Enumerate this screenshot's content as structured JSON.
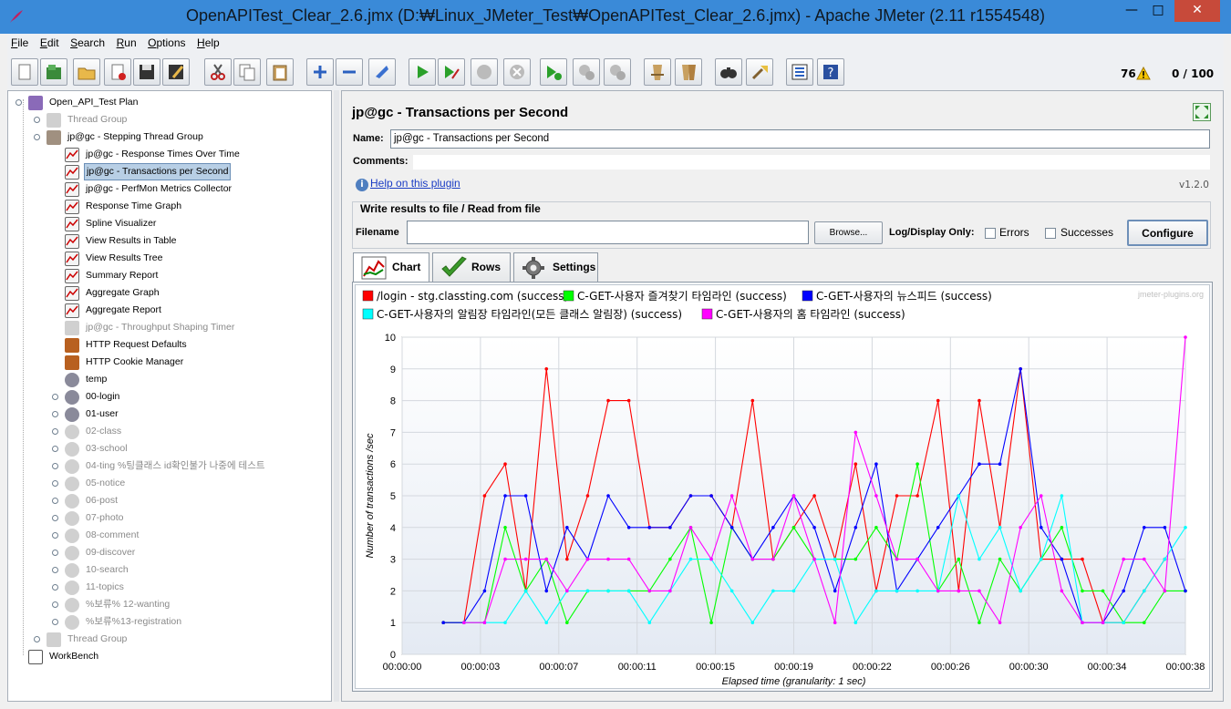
{
  "window": {
    "title": "OpenAPITest_Clear_2.6.jmx (D:₩Linux_JMeter_Test₩OpenAPITest_Clear_2.6.jmx) - Apache JMeter (2.11 r1554548)",
    "minimize": "—",
    "maximize": "□",
    "close": "✕"
  },
  "menu": [
    "File",
    "Edit",
    "Search",
    "Run",
    "Options",
    "Help"
  ],
  "toolbar": {
    "buttons": [
      "new-icon",
      "templates-icon",
      "open-icon",
      "close-file-icon",
      "save-icon",
      "save-as-icon",
      "cut-icon",
      "copy-icon",
      "paste-icon",
      "expand-icon",
      "collapse-icon",
      "toggle-icon",
      "start-icon",
      "start-no-pause-icon",
      "stop-icon",
      "shutdown-icon",
      "remote-start-icon",
      "remote-stop-icon",
      "remote-shutdown-icon",
      "clear-icon",
      "clear-all-icon",
      "search-icon",
      "reset-search-icon",
      "function-helper-icon",
      "help-icon"
    ],
    "error_count": "76",
    "threads": "0 / 100"
  },
  "tree": {
    "nodes": [
      {
        "label": "Open_API_Test Plan",
        "level": 0,
        "icon": "test-plan-icon",
        "disabled": false,
        "selected": false,
        "toggle": true
      },
      {
        "label": "Thread Group",
        "level": 1,
        "icon": "thread-group-icon",
        "disabled": true,
        "selected": false,
        "toggle": true
      },
      {
        "label": "jp@gc - Stepping Thread Group",
        "level": 1,
        "icon": "thread-group-icon",
        "disabled": false,
        "selected": false,
        "toggle": true
      },
      {
        "label": "jp@gc - Response Times Over Time",
        "level": 2,
        "icon": "listener-icon",
        "disabled": false,
        "selected": false
      },
      {
        "label": "jp@gc - Transactions per Second",
        "level": 2,
        "icon": "listener-icon",
        "disabled": false,
        "selected": true
      },
      {
        "label": "jp@gc - PerfMon Metrics Collector",
        "level": 2,
        "icon": "listener-icon",
        "disabled": false,
        "selected": false
      },
      {
        "label": "Response Time Graph",
        "level": 2,
        "icon": "listener-icon",
        "disabled": false,
        "selected": false
      },
      {
        "label": "Spline Visualizer",
        "level": 2,
        "icon": "listener-icon",
        "disabled": false,
        "selected": false
      },
      {
        "label": "View Results in Table",
        "level": 2,
        "icon": "listener-icon",
        "disabled": false,
        "selected": false
      },
      {
        "label": "View Results Tree",
        "level": 2,
        "icon": "listener-icon",
        "disabled": false,
        "selected": false
      },
      {
        "label": "Summary Report",
        "level": 2,
        "icon": "listener-icon",
        "disabled": false,
        "selected": false
      },
      {
        "label": "Aggregate Graph",
        "level": 2,
        "icon": "listener-icon",
        "disabled": false,
        "selected": false
      },
      {
        "label": "Aggregate Report",
        "level": 2,
        "icon": "listener-icon",
        "disabled": false,
        "selected": false
      },
      {
        "label": "jp@gc - Throughput Shaping Timer",
        "level": 2,
        "icon": "timer-icon",
        "disabled": true,
        "selected": false
      },
      {
        "label": "HTTP Request Defaults",
        "level": 2,
        "icon": "config-icon",
        "disabled": false,
        "selected": false
      },
      {
        "label": "HTTP Cookie Manager",
        "level": 2,
        "icon": "config-icon",
        "disabled": false,
        "selected": false
      },
      {
        "label": "temp",
        "level": 2,
        "icon": "controller-icon",
        "disabled": false,
        "selected": false
      },
      {
        "label": "00-login",
        "level": 2,
        "icon": "controller-icon",
        "disabled": false,
        "selected": false,
        "toggle": true
      },
      {
        "label": "01-user",
        "level": 2,
        "icon": "controller-icon",
        "disabled": false,
        "selected": false,
        "toggle": true
      },
      {
        "label": "02-class",
        "level": 2,
        "icon": "controller-icon",
        "disabled": true,
        "selected": false,
        "toggle": true
      },
      {
        "label": "03-school",
        "level": 2,
        "icon": "controller-icon",
        "disabled": true,
        "selected": false,
        "toggle": true
      },
      {
        "label": "04-ting %팅클래스 id확인불가 나중에 테스트",
        "level": 2,
        "icon": "controller-icon",
        "disabled": true,
        "selected": false,
        "toggle": true
      },
      {
        "label": "05-notice",
        "level": 2,
        "icon": "controller-icon",
        "disabled": true,
        "selected": false,
        "toggle": true
      },
      {
        "label": "06-post",
        "level": 2,
        "icon": "controller-icon",
        "disabled": true,
        "selected": false,
        "toggle": true
      },
      {
        "label": "07-photo",
        "level": 2,
        "icon": "controller-icon",
        "disabled": true,
        "selected": false,
        "toggle": true
      },
      {
        "label": "08-comment",
        "level": 2,
        "icon": "controller-icon",
        "disabled": true,
        "selected": false,
        "toggle": true
      },
      {
        "label": "09-discover",
        "level": 2,
        "icon": "controller-icon",
        "disabled": true,
        "selected": false,
        "toggle": true
      },
      {
        "label": "10-search",
        "level": 2,
        "icon": "controller-icon",
        "disabled": true,
        "selected": false,
        "toggle": true
      },
      {
        "label": "11-topics",
        "level": 2,
        "icon": "controller-icon",
        "disabled": true,
        "selected": false,
        "toggle": true
      },
      {
        "label": "%보류% 12-wanting",
        "level": 2,
        "icon": "controller-icon",
        "disabled": true,
        "selected": false,
        "toggle": true
      },
      {
        "label": "%보류%13-registration",
        "level": 2,
        "icon": "controller-icon",
        "disabled": true,
        "selected": false,
        "toggle": true
      },
      {
        "label": "Thread Group",
        "level": 1,
        "icon": "thread-group-icon",
        "disabled": true,
        "selected": false,
        "toggle": true
      },
      {
        "label": "WorkBench",
        "level": 0,
        "icon": "workbench-icon",
        "disabled": false,
        "selected": false
      }
    ]
  },
  "panel": {
    "title": "jp@gc - Transactions per Second",
    "name_label": "Name:",
    "name_value": "jp@gc - Transactions per Second",
    "comments_label": "Comments:",
    "help_link": "Help on this plugin",
    "version": "v1.2.0",
    "write_title": "Write results to file / Read from file",
    "filename_label": "Filename",
    "browse": "Browse...",
    "log_display_label": "Log/Display Only:",
    "errors_label": "Errors",
    "successes_label": "Successes",
    "configure": "Configure",
    "tabs": [
      "Chart",
      "Rows",
      "Settings"
    ],
    "watermark": "jmeter-plugins.org"
  },
  "chart_data": {
    "type": "line",
    "xlabel": "Elapsed time (granularity: 1 sec)",
    "ylabel": "Number of transactions /sec",
    "ylim": [
      0,
      10
    ],
    "xlim": [
      0,
      38
    ],
    "x_ticks": [
      "00:00:00",
      "00:00:03",
      "00:00:07",
      "00:00:11",
      "00:00:15",
      "00:00:19",
      "00:00:22",
      "00:00:26",
      "00:00:30",
      "00:00:34",
      "00:00:38"
    ],
    "y_ticks": [
      0,
      1,
      2,
      3,
      4,
      5,
      6,
      7,
      8,
      9,
      10
    ],
    "legend_position": "top",
    "grid": true,
    "series": [
      {
        "name": "/login - stg.classting.com (success)",
        "color": "#ff0000",
        "x": [
          2,
          3,
          4,
          5,
          6,
          7,
          8,
          9,
          10,
          11,
          12,
          13,
          14,
          15,
          16,
          17,
          18,
          19,
          20,
          21,
          22,
          23,
          24,
          25,
          26,
          27,
          28,
          29,
          30,
          31,
          32,
          33,
          34,
          35,
          36,
          37
        ],
        "y": [
          1,
          1,
          5,
          6,
          2,
          9,
          3,
          5,
          8,
          8,
          4,
          4,
          5,
          5,
          4,
          8,
          3,
          4,
          5,
          3,
          6,
          2,
          5,
          5,
          8,
          2,
          8,
          4,
          9,
          3,
          3,
          3,
          1,
          1,
          2,
          3
        ]
      },
      {
        "name": "C-GET-사용자 즐겨찾기 타임라인 (success)",
        "color": "#00ff00",
        "x": [
          2,
          3,
          4,
          5,
          6,
          7,
          8,
          9,
          10,
          11,
          12,
          13,
          14,
          15,
          16,
          17,
          18,
          19,
          20,
          21,
          22,
          23,
          24,
          25,
          26,
          27,
          28,
          29,
          30,
          31,
          32,
          33,
          34,
          35,
          36,
          37,
          38
        ],
        "y": [
          1,
          1,
          1,
          4,
          2,
          3,
          1,
          2,
          2,
          2,
          2,
          3,
          4,
          1,
          4,
          3,
          3,
          4,
          3,
          3,
          3,
          4,
          3,
          6,
          2,
          3,
          1,
          3,
          2,
          3,
          4,
          2,
          2,
          1,
          1,
          2,
          2
        ]
      },
      {
        "name": "C-GET-사용자의 뉴스피드 (success)",
        "color": "#0000ff",
        "x": [
          2,
          3,
          4,
          5,
          6,
          7,
          8,
          9,
          10,
          11,
          12,
          13,
          14,
          15,
          16,
          17,
          18,
          19,
          20,
          21,
          22,
          23,
          24,
          25,
          26,
          27,
          28,
          29,
          30,
          31,
          32,
          33,
          34,
          35,
          36,
          37,
          38
        ],
        "y": [
          1,
          1,
          2,
          5,
          5,
          2,
          4,
          3,
          5,
          4,
          4,
          4,
          5,
          5,
          4,
          3,
          4,
          5,
          4,
          2,
          4,
          6,
          2,
          3,
          4,
          5,
          6,
          6,
          9,
          4,
          3,
          1,
          1,
          2,
          4,
          4,
          2
        ]
      },
      {
        "name": "C-GET-사용자의 알림장 타임라인(모든 클래스 알림장) (success)",
        "color": "#00ffff",
        "x": [
          3,
          4,
          5,
          6,
          7,
          8,
          9,
          10,
          11,
          12,
          13,
          14,
          15,
          16,
          17,
          18,
          19,
          20,
          21,
          22,
          23,
          24,
          25,
          26,
          27,
          28,
          29,
          30,
          31,
          32,
          33,
          34,
          35,
          36,
          37,
          38
        ],
        "y": [
          1,
          1,
          1,
          2,
          1,
          2,
          2,
          2,
          2,
          1,
          2,
          3,
          3,
          2,
          1,
          2,
          2,
          3,
          3,
          1,
          2,
          2,
          2,
          2,
          5,
          3,
          4,
          2,
          3,
          5,
          1,
          1,
          1,
          2,
          3,
          4
        ]
      },
      {
        "name": "C-GET-사용자의 홈 타임라인 (success)",
        "color": "#ff00ff",
        "x": [
          3,
          4,
          5,
          6,
          7,
          8,
          9,
          10,
          11,
          12,
          13,
          14,
          15,
          16,
          17,
          18,
          19,
          20,
          21,
          22,
          23,
          24,
          25,
          26,
          27,
          28,
          29,
          30,
          31,
          32,
          33,
          34,
          35,
          36,
          37,
          38
        ],
        "y": [
          1,
          1,
          3,
          3,
          3,
          2,
          3,
          3,
          3,
          2,
          2,
          4,
          3,
          5,
          3,
          3,
          5,
          3,
          1,
          7,
          5,
          3,
          3,
          2,
          2,
          2,
          1,
          4,
          5,
          2,
          1,
          1,
          3,
          3,
          2,
          10
        ]
      }
    ]
  }
}
